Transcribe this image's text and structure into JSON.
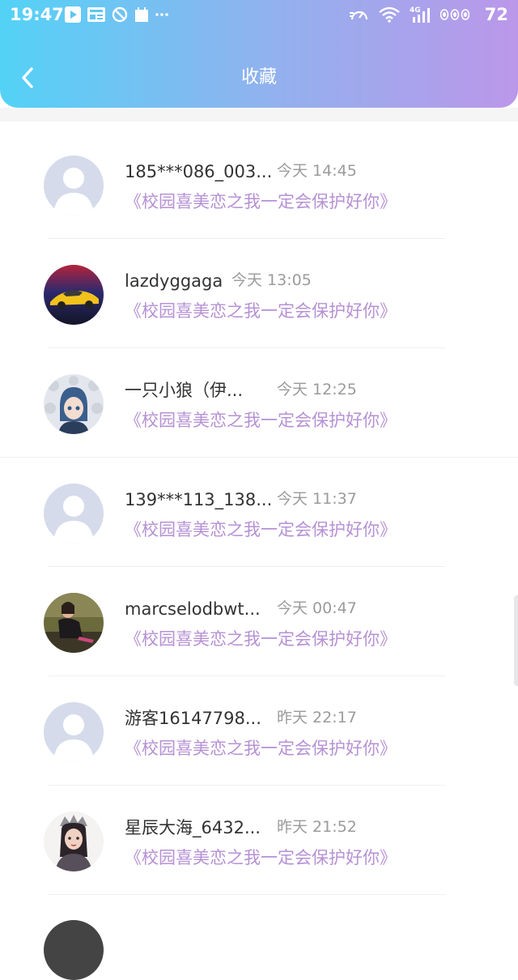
{
  "status_bar": {
    "time": "19:47",
    "battery": "72",
    "network": "4G",
    "left_icons": [
      "play-icon",
      "news-icon",
      "dnd-icon",
      "calendar-icon",
      "more-icon"
    ],
    "right_icons": [
      "speed-icon",
      "wifi-icon",
      "cell-signal-icon",
      "indicator-icon"
    ]
  },
  "header": {
    "title": "收藏",
    "back_icon": "chevron-left-icon"
  },
  "colors": {
    "gradient_start": "#53d2f6",
    "gradient_end": "#bb97ea",
    "novel_title": "#b691d4",
    "username": "#333333",
    "timestamp": "#9b9b9b"
  },
  "items": [
    {
      "username": "185***086_003...",
      "time": "今天 14:45",
      "novel": "《校园喜美恋之我一定会保护好你》",
      "avatar": "default-avatar-icon"
    },
    {
      "username": "lazdyggaga",
      "time": "今天 13:05",
      "novel": "《校园喜美恋之我一定会保护好你》",
      "avatar": "sports-car-avatar"
    },
    {
      "username": "一只小狼（伊...",
      "time": "今天 12:25",
      "novel": "《校园喜美恋之我一定会保护好你》",
      "avatar": "anime-girl-avatar"
    },
    {
      "username": "139***113_138...",
      "time": "今天 11:37",
      "novel": "《校园喜美恋之我一定会保护好你》",
      "avatar": "default-avatar-icon"
    },
    {
      "username": "marcselodbwt...",
      "time": "今天 00:47",
      "novel": "《校园喜美恋之我一定会保护好你》",
      "avatar": "woman-photo-avatar"
    },
    {
      "username": "游客16147798...",
      "time": "昨天 22:17",
      "novel": "《校园喜美恋之我一定会保护好你》",
      "avatar": "default-avatar-icon"
    },
    {
      "username": "星辰大海_6432...",
      "time": "昨天 21:52",
      "novel": "《校园喜美恋之我一定会保护好你》",
      "avatar": "costume-girl-avatar"
    }
  ]
}
